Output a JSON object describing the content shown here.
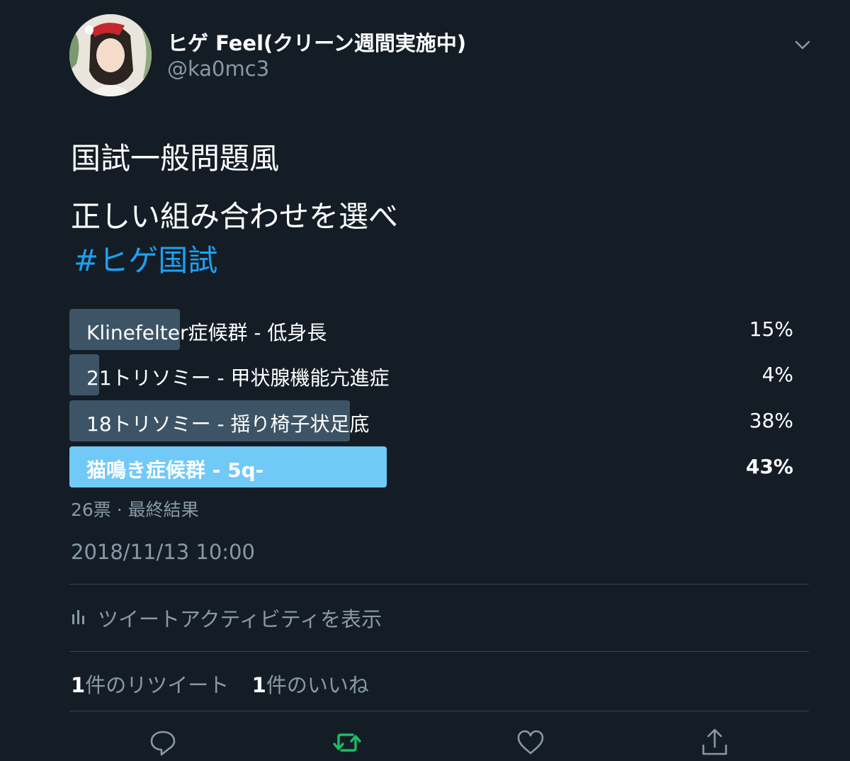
{
  "user": {
    "display_name": "ヒゲ Feel(クリーン週間実施中)",
    "handle": "@ka0mc3"
  },
  "tweet": {
    "line1": "国試一般問題風",
    "line2": "正しい組み合わせを選べ",
    "hashtag": "#ヒゲ国試"
  },
  "poll": {
    "options": [
      {
        "label": "Klinefelter症候群  -  低身長",
        "percent": 15,
        "percent_text": "15%",
        "winner": false
      },
      {
        "label": "21トリソミー   -  甲状腺機能亢進症",
        "percent": 4,
        "percent_text": "4%",
        "winner": false
      },
      {
        "label": "18トリソミー  -   揺り椅子状足底",
        "percent": 38,
        "percent_text": "38%",
        "winner": false
      },
      {
        "label": "猫鳴き症候群  -  5q-",
        "percent": 43,
        "percent_text": "43%",
        "winner": true
      }
    ],
    "summary": "26票 · 最終結果"
  },
  "timestamp": "2018/11/13 10:00",
  "activity_label": "ツイートアクティビティを表示",
  "stats": {
    "retweet_count": "1",
    "retweet_label": "件のリツイート",
    "like_count": "1",
    "like_label": "件のいいね"
  },
  "colors": {
    "background": "#141d26",
    "bar": "#3d5466",
    "winner_bar": "#71c9f8",
    "link": "#1da1f2",
    "retweet_active": "#17bf63",
    "muted": "#8899a6"
  },
  "icons": [
    "menu-chevron-icon",
    "activity-chart-icon",
    "reply-icon",
    "retweet-icon",
    "like-icon",
    "share-icon"
  ]
}
